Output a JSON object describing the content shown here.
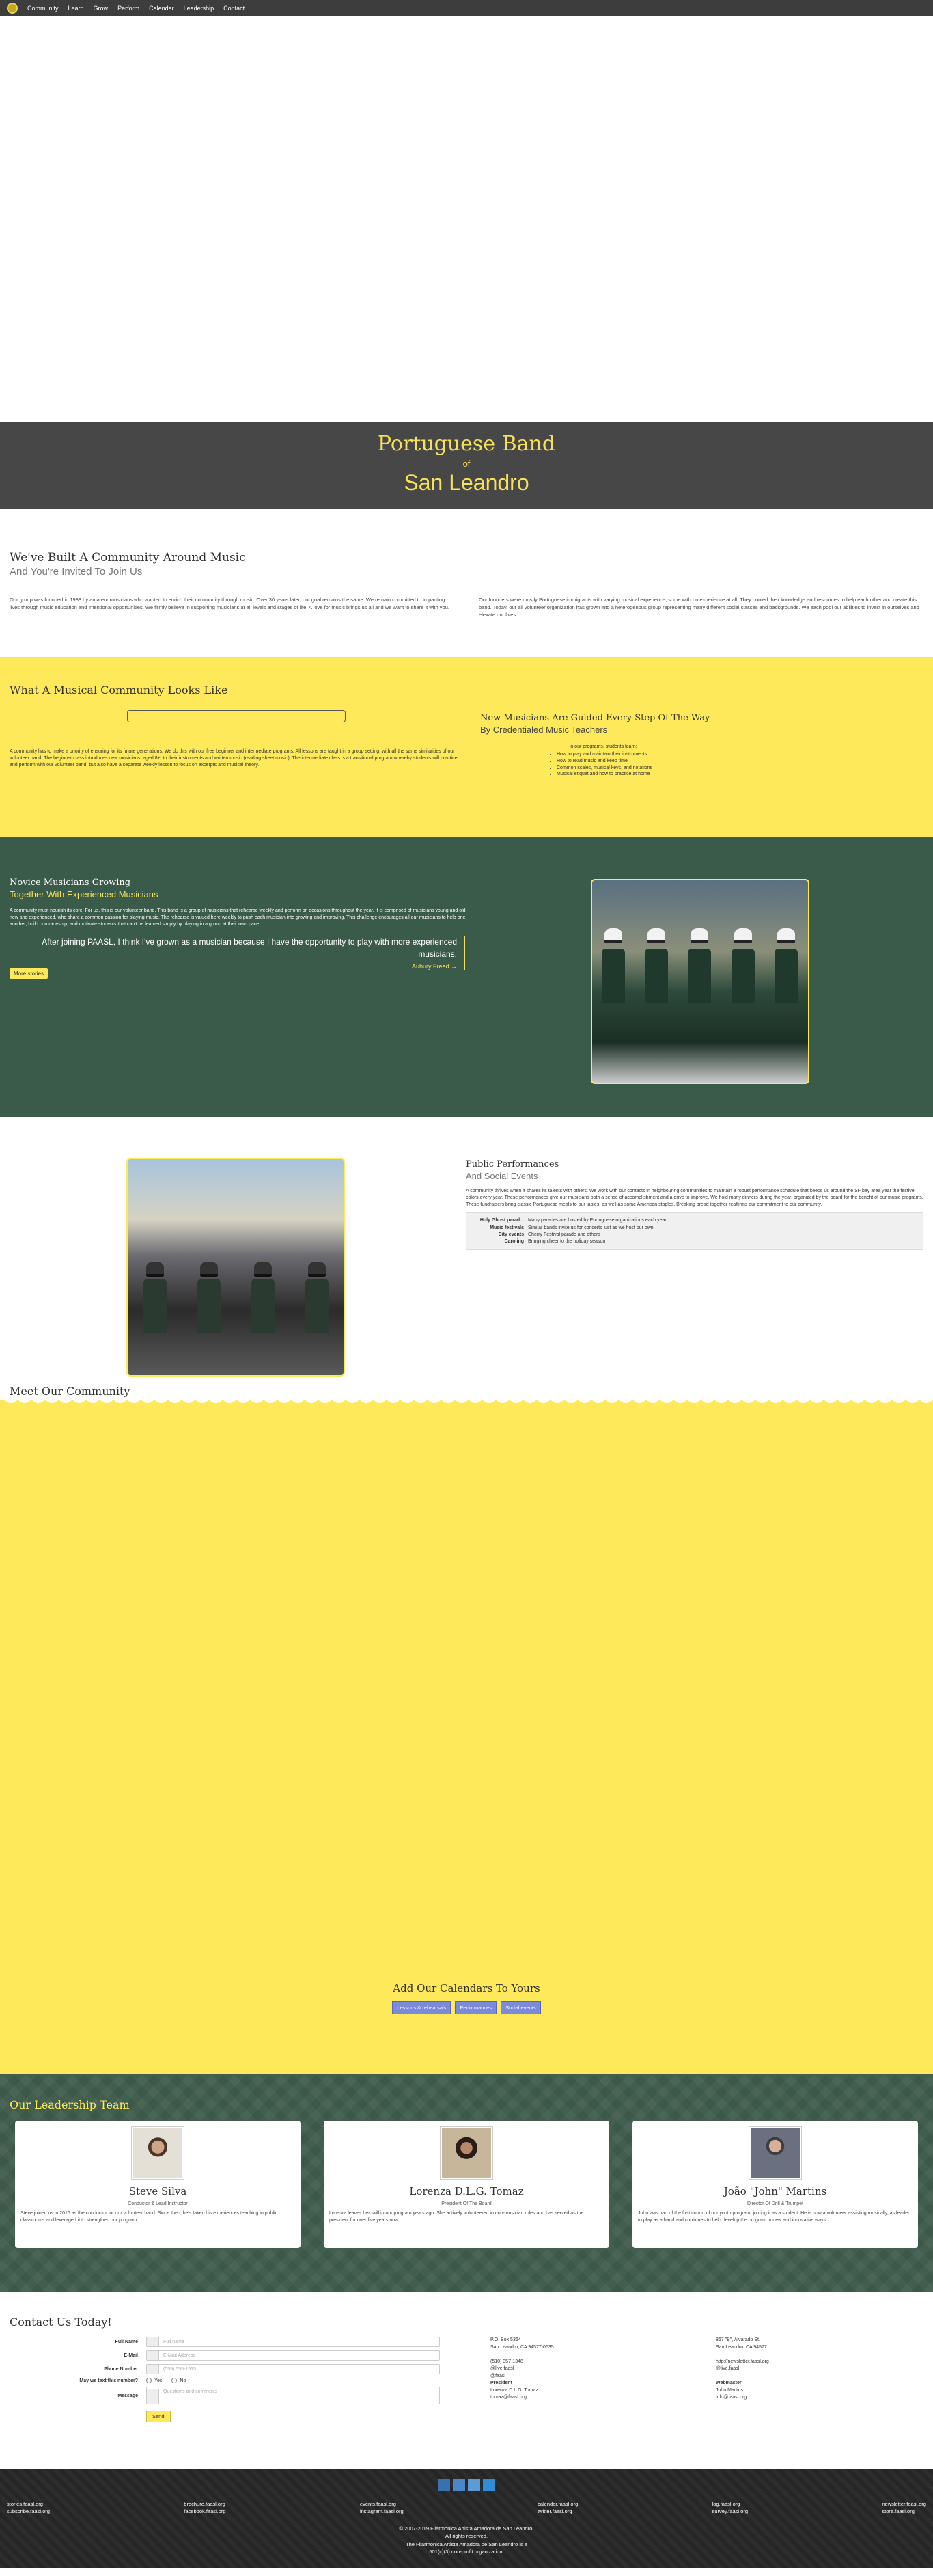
{
  "nav": {
    "items": [
      "Community",
      "Learn",
      "Grow",
      "Perform",
      "Calendar",
      "Leadership",
      "Contact"
    ]
  },
  "hero": {
    "line1": "Portuguese Band",
    "line2": "of",
    "line3": "San Leandro"
  },
  "community": {
    "title": "We've Built A Community Around Music",
    "subtitle": "And You're Invited To Join Us",
    "para1": "Our group was founded in 1988 by amateur musicians who wanted to enrich their community through music. Over 30 years later, our goal remains the same. We remain committed to impacting lives through music education and intentional opportunities. We firmly believe in supporting musicians at all levels and stages of life. A love for music brings us all and we want to share it with you.",
    "para2": "Our founders were mostly Portuguese immigrants with varying musical experience; some with no experience at all. They pooled their knowledge and resources to help each other and create this band. Today, our all volunteer organization has grown into a heterogenous group representing many different social classes and backgrounds. We each pool our abilities to invest in ourselves and elevate our lives."
  },
  "musical": {
    "title": "What A Musical Community Looks Like",
    "left_text": "A community has to make a priority of ensuring for its future generations. We do this with our free beginner and intermediate programs. All lessons are taught in a group setting, with all the same similarities of our volunteer band. The beginner class introduces new musicians, aged 8+, to their instruments and written music (reading sheet music). The intermediate class is a transitional program whereby students will practice and perform with our volunteer band, but also have a separate weekly lesson to focus on excerpts and musical theory.",
    "right_title": "New Musicians Are Guided Every Step Of The Way",
    "right_subtitle": "By Credentialed Music Teachers",
    "right_intro": "In our programs, students learn:",
    "right_list": [
      "How to play and maintain their instruments",
      "How to read music and keep time",
      "Common scales, musical keys, and notations",
      "Musical etiquet and how to practice at home"
    ]
  },
  "novice": {
    "title": "Novice Musicians Growing",
    "subtitle": "Together With Experienced Musicians",
    "text": "A community must nourish its core. For us, this is our volunteer band. This band is a group of musicians that rehearse weekly and perform on occasions throughout the year. It is comprised of musicians young and old, new and experienced, who share a common passion for playing music. The rehearse is valued here weekly to push each musician into growing and improving. This challenge encourages all our musicians to help one another, build comradeship, and motivate students that can't be learned simply by playing in a group at their own pace.",
    "quote": "After joining PAASL, I think I've grown as a musician because I have the opportunity to play with more experienced musicians.",
    "author": "Aubury Freed →",
    "more_button": "More stories"
  },
  "public": {
    "title": "Public Performances",
    "subtitle": "And Social Events",
    "text": "A community thrives when it shares its talents with others. We work with our contacts in neighbouring communities to maintain a robust performance schedule that keeps us around the SF bay area year the festive colors every year. These performances give our musicians both a sense of accomplishment and a drive to improve. We hold many dinners during the year, organized by the board for the benefit of our music programs. These fundraisers bring classic Portuguese meals to our tables, as well as some American staples. Breaking bread together reaffirms our commitment to our community.",
    "rows": [
      {
        "k": "Holy Ghost parad...",
        "v": "Many parades are hosted by Portuguese organizations each year"
      },
      {
        "k": "Music festivals",
        "v": "Similar bands invite us for concerts just as we host our own"
      },
      {
        "k": "City events",
        "v": "Cherry Festival parade and others"
      },
      {
        "k": "Caroling",
        "v": "Bringing cheer to the holiday season"
      }
    ]
  },
  "meet": {
    "title": "Meet Our Community",
    "calendars_title": "Add Our Calendars To Yours",
    "calendar_buttons": [
      "Lessons & rehearsals",
      "Performances",
      "Social events"
    ]
  },
  "leaders": {
    "title": "Our Leadership Team",
    "people": [
      {
        "name": "Steve Silva",
        "role": "Conductor & Lead Instructor",
        "bio": "Steve joined us in 2016 as the conductor for our volunteer band. Since then, he's taken his experiences teaching in public classrooms and leveraged it to strengthen our program."
      },
      {
        "name": "Lorenza D.L.G. Tomaz",
        "role": "President Of The Board",
        "bio": "Lorenza leaves her skill in our program years ago. She actively volunteered in non-musician roles and has served as the president for over five years now."
      },
      {
        "name": "João \"John\" Martins",
        "role": "Director Of Drill & Trumpet",
        "bio": "John was part of the first cohort of our youth program, joining it as a student. He is now a volunteer assisting musically, as leader to play as a band and continues to help develop the program in new and innovative ways."
      }
    ]
  },
  "contact": {
    "title": "Contact Us Today!",
    "form": {
      "name_label": "Full Name",
      "name_ph": "Full name",
      "email_label": "E-Mail",
      "email_ph": "E-Mail Address",
      "phone_label": "Phone Number",
      "phone_ph": "(555) 555-1515",
      "text_label": "May we text this number?",
      "yes": "Yes",
      "no": "No",
      "message_label": "Message",
      "message_ph": "Questions and comments",
      "send": "Send"
    },
    "info1": {
      "addr1": "P.O. Box 5364",
      "addr2": "San Leandro, CA 94577-0535",
      "phone": "(510) 357-1348",
      "email_note": "@live.faasl",
      "role_note": "@faasl",
      "role": "President",
      "name": "Lorenza D.L.G. Tomaz",
      "email": "tomaz@faasl.org"
    },
    "info2": {
      "addr1": "867 \"B\", Alvarado St.",
      "addr2": "San Leandro, CA 94577",
      "web": "http://newsletter.faasl.org",
      "email_note": "@live.faasl",
      "role": "Webmaster",
      "name": "John Martins",
      "email": "info@faasl.org"
    }
  },
  "footer": {
    "links_col1": [
      "stories.faasl.org",
      "subscribe.faasl.org"
    ],
    "links_col2": [
      "brochure.faasl.org",
      "facebook.faasl.org"
    ],
    "links_col3": [
      "events.faasl.org",
      "instagram.faasl.org"
    ],
    "links_col4": [
      "calendar.faasl.org",
      "twitter.faasl.org"
    ],
    "links_col5": [
      "log.faasl.org",
      "survey.faasl.org"
    ],
    "links_col6": [
      "newsletter.faasl.org",
      "store.faasl.org"
    ],
    "copy1": "© 2007-2019 Filarmonica Artista Amadora de San Leandro.",
    "copy2": "All rights reserved.",
    "copy3": "The Filarmonica Artista Amadora de San Leandro is a",
    "copy4": "501(c)(3) non-profit organization."
  }
}
